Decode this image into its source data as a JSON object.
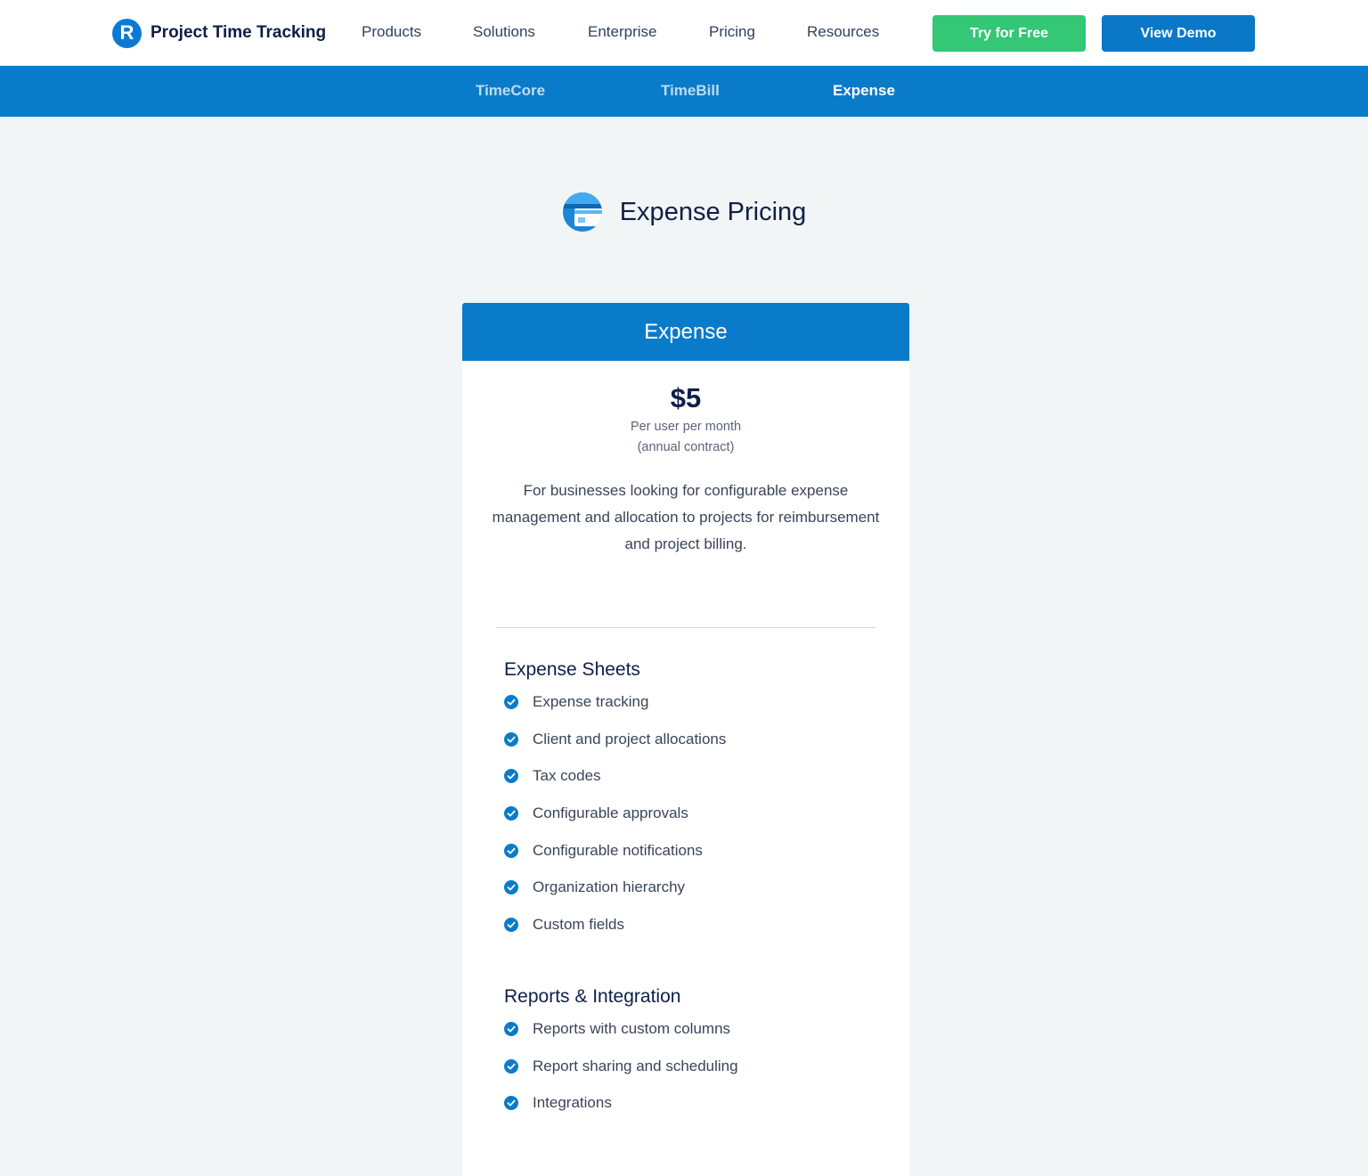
{
  "header": {
    "brand_initial": "R",
    "brand_name": "Project Time Tracking",
    "nav": [
      {
        "label": "Products"
      },
      {
        "label": "Solutions"
      },
      {
        "label": "Enterprise"
      },
      {
        "label": "Pricing"
      },
      {
        "label": "Resources"
      }
    ],
    "try_label": "Try for Free",
    "demo_label": "View Demo"
  },
  "subnav": {
    "items": [
      {
        "label": "TimeCore"
      },
      {
        "label": "TimeBill"
      },
      {
        "label": "Expense"
      }
    ],
    "active": "Expense"
  },
  "page": {
    "title": "Expense Pricing",
    "icon": "expense-card-icon"
  },
  "plan": {
    "name": "Expense",
    "price": "$5",
    "price_note_1": "Per user per month",
    "price_note_2": "(annual contract)",
    "description": "For businesses looking for configurable expense management and allocation to projects for reimbursement and project billing.",
    "sections": [
      {
        "title": "Expense Sheets",
        "features": [
          "Expense tracking",
          "Client and project allocations",
          "Tax codes",
          "Configurable approvals",
          "Configurable notifications",
          "Organization hierarchy",
          "Custom fields"
        ]
      },
      {
        "title": "Reports & Integration",
        "features": [
          "Reports with custom columns",
          "Report sharing and scheduling",
          "Integrations"
        ]
      }
    ]
  },
  "colors": {
    "brand_blue": "#0a7bc8",
    "try_green": "#33c776",
    "heading_navy": "#0f1f48"
  }
}
